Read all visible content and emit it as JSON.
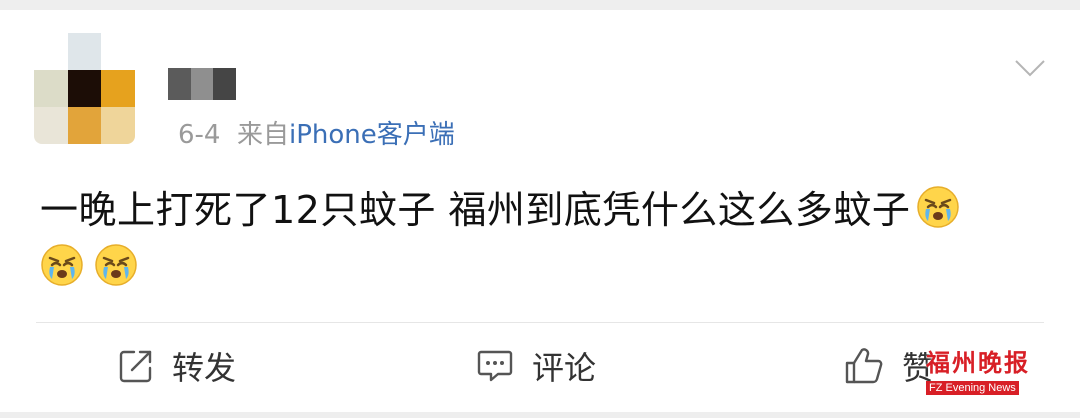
{
  "post": {
    "date": "6-4",
    "from_label": "来自",
    "source": "iPhone客户端",
    "content": "一晚上打死了12只蚊子 福州到底凭什么这么多蚊子",
    "emoji": "crying-face"
  },
  "actions": {
    "repost_label": "转发",
    "comment_label": "评论",
    "like_label": "赞"
  },
  "watermark": {
    "title": "福州晚报",
    "subtitle": "FZ Evening News"
  },
  "icons": [
    "chevron-down-icon",
    "repost-icon",
    "comment-icon",
    "like-icon",
    "crying-face-emoji"
  ],
  "colors": {
    "accent_link": "#3b6fb6",
    "meta_gray": "#9a9a9a",
    "watermark_red": "#d81f26"
  }
}
